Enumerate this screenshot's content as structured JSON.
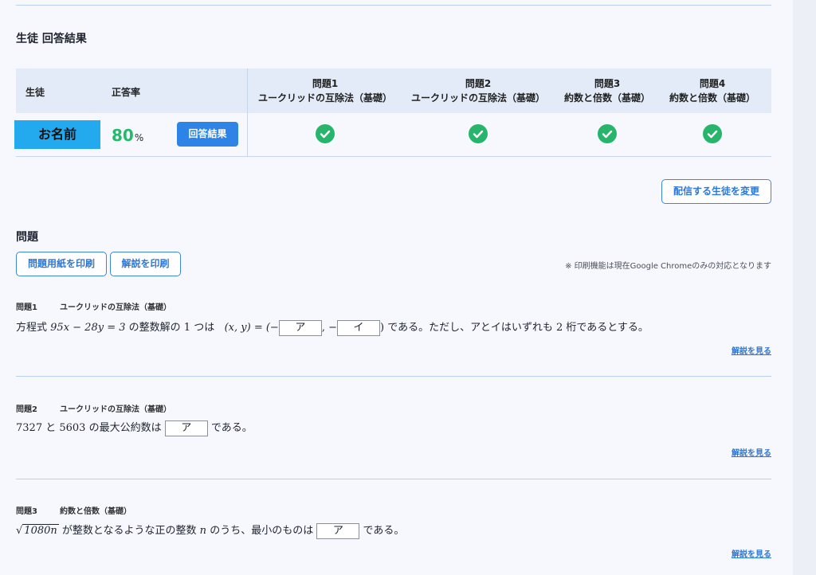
{
  "results": {
    "title": "生徒 回答結果",
    "col_student": "生徒",
    "col_rate": "正答率",
    "student_name": "お名前",
    "rate_value": "80",
    "rate_unit": "%",
    "answer_button": "回答結果",
    "questions": [
      {
        "num": "問題1",
        "title": "ユークリッドの互除法（基礎）",
        "result": "correct"
      },
      {
        "num": "問題2",
        "title": "ユークリッドの互除法（基礎）",
        "result": "correct"
      },
      {
        "num": "問題3",
        "title": "約数と倍数（基礎）",
        "result": "correct"
      },
      {
        "num": "問題4",
        "title": "約数と倍数（基礎）",
        "result": "correct"
      }
    ],
    "icon": "check-circle-icon",
    "check_color": "#27b56b"
  },
  "change_students_button": "配信する生徒を変更",
  "problems": {
    "title": "問題",
    "print_problem_button": "問題用紙を印刷",
    "print_explain_button": "解説を印刷",
    "print_note": "※ 印刷機能は現在Google Chromeのみの対応となります",
    "explain_link": "解説を見る",
    "items": [
      {
        "num": "問題1",
        "title": "ユークリッドの互除法（基礎）",
        "text_pre": "方程式",
        "eq": "95x − 28y = 3",
        "text_mid": "の整数解の 1 つは",
        "pair": "(x, y) = (−",
        "box1": "ア",
        "comma": ", −",
        "box2": "イ",
        "text_post": ") である。ただし、アとイはいずれも 2 桁であるとする。"
      },
      {
        "num": "問題2",
        "title": "ユークリッドの互除法（基礎）",
        "text_pre": "7327 と 5603 の最大公約数は",
        "box1": "ア",
        "text_post": "である。"
      },
      {
        "num": "問題3",
        "title": "約数と倍数（基礎）",
        "sqrt_inner": "1080n",
        "text_pre": "が整数となるような正の整数",
        "var": "n",
        "text_mid": "のうち、最小のものは",
        "box1": "ア",
        "text_post": "である。"
      }
    ]
  },
  "colors": {
    "accent": "#2d83e6",
    "badge": "#23a9ee",
    "rate": "#26b86b"
  }
}
